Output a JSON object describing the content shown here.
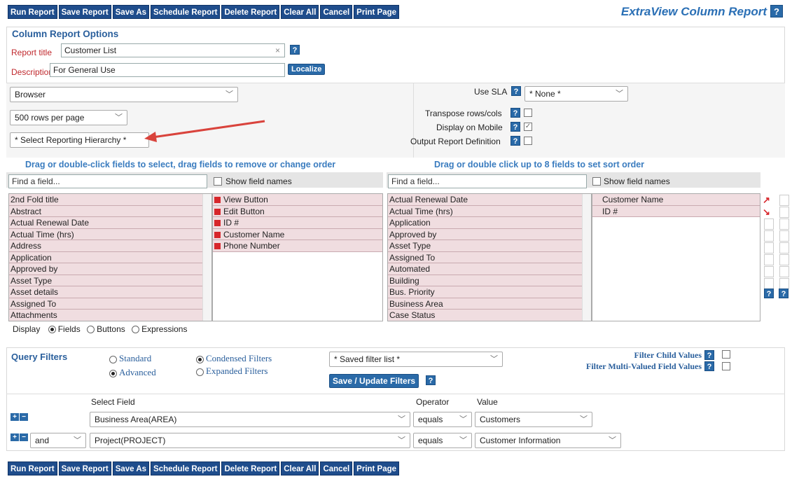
{
  "toolbar": [
    "Run Report",
    "Save Report",
    "Save As",
    "Schedule Report",
    "Delete Report",
    "Clear All",
    "Cancel",
    "Print Page"
  ],
  "page_title": "ExtraView Column Report",
  "help_glyph": "?",
  "options": {
    "heading": "Column Report Options",
    "report_title_label": "Report title",
    "report_title_value": "Customer List",
    "description_label": "Description",
    "description_value": "For General Use",
    "localize_label": "Localize",
    "output_select": "Browser",
    "rows_select": "500 rows per page",
    "hierarchy_select": "* Select Reporting Hierarchy *",
    "use_sla_label": "Use SLA",
    "use_sla_value": "* None *",
    "transpose_label": "Transpose rows/cols",
    "mobile_label": "Display on Mobile",
    "output_def_label": "Output Report Definition"
  },
  "fields": {
    "left_heading": "Drag or double-click fields to select, drag fields to remove or change order",
    "right_heading": "Drag or double click up to 8 fields to set sort order",
    "find_placeholder": "Find a field...",
    "show_names": "Show field names",
    "available": [
      "2nd Fold title",
      "Abstract",
      "Actual Renewal Date",
      "Actual Time (hrs)",
      "Address",
      "Application",
      "Approved by",
      "Asset Type",
      "Asset details",
      "Assigned To",
      "Attachments"
    ],
    "selected": [
      "View Button",
      "Edit Button",
      "ID #",
      "Customer Name",
      "Phone Number"
    ],
    "sort_available": [
      "Actual Renewal Date",
      "Actual Time (hrs)",
      "Application",
      "Approved by",
      "Asset Type",
      "Assigned To",
      "Automated",
      "Building",
      "Bus. Priority",
      "Business Area",
      "Case Status"
    ],
    "sort_selected": [
      "Customer Name",
      "ID #"
    ],
    "display_label": "Display",
    "display_options": [
      "Fields",
      "Buttons",
      "Expressions"
    ]
  },
  "query": {
    "heading": "Query Filters",
    "standard": "Standard",
    "advanced": "Advanced",
    "condensed": "Condensed Filters",
    "expanded": "Expanded Filters",
    "saved_list": "* Saved filter list *",
    "save_update": "Save / Update Filters",
    "filter_child": "Filter Child Values",
    "filter_multi": "Filter Multi-Valued Field Values",
    "col_select": "Select Field",
    "col_operator": "Operator",
    "col_value": "Value",
    "rows": [
      {
        "conj": "",
        "field": "Business Area(AREA)",
        "op": "equals",
        "value": "Customers"
      },
      {
        "conj": "and",
        "field": "Project(PROJECT)",
        "op": "equals",
        "value": "Customer Information"
      }
    ]
  }
}
